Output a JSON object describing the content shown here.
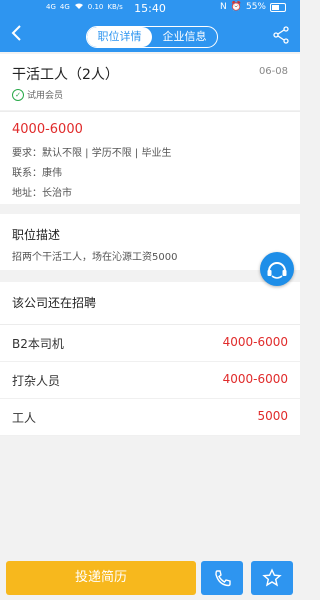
{
  "status_bar": {
    "time": "15:40",
    "net_speed": "0.10",
    "net_unit": "KB/s",
    "left_labels": [
      "4G",
      "4G"
    ],
    "battery": "55%"
  },
  "header": {
    "tabs": [
      {
        "label": "职位详情",
        "active": true
      },
      {
        "label": "企业信息",
        "active": false
      }
    ]
  },
  "job": {
    "title": "干活工人（2人）",
    "date": "06-08",
    "member_badge": "试用会员",
    "salary": "4000-6000",
    "requirement_label": "要求：",
    "requirement_value": "默认不限 | 学历不限 | 毕业生",
    "contact_label": "联系：",
    "contact_value": "康伟",
    "address_label": "地址：",
    "address_value": "长治市"
  },
  "description": {
    "heading": "职位描述",
    "text": "招两个干活工人，场在沁源工资5000"
  },
  "recruiting": {
    "heading": "该公司还在招聘",
    "items": [
      {
        "name": "B2本司机",
        "salary": "4000-6000"
      },
      {
        "name": "打杂人员",
        "salary": "4000-6000"
      },
      {
        "name": "工人",
        "salary": "5000"
      }
    ]
  },
  "bottom_bar": {
    "apply_label": "投递简历"
  },
  "colors": {
    "primary": "#2e95f0",
    "salary_red": "#e02b2b",
    "apply_yellow": "#f7b81d",
    "member_green": "#2aa94a"
  }
}
